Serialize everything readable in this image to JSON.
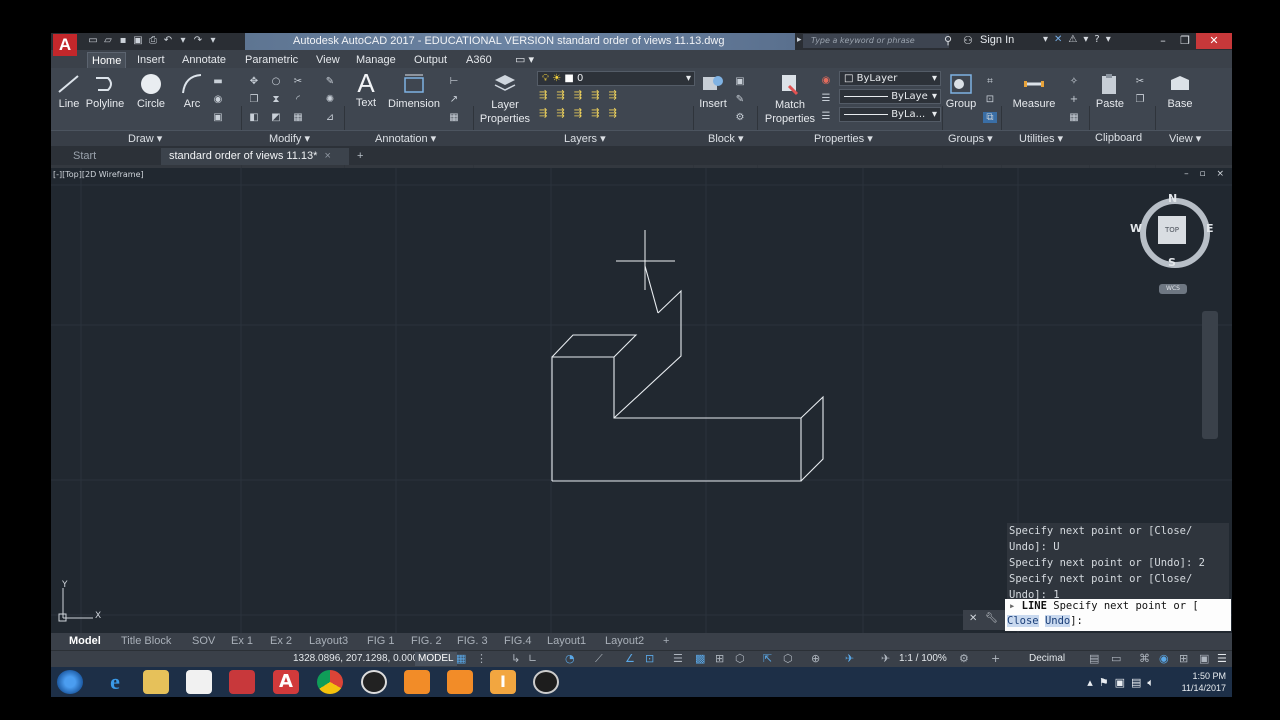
{
  "titlebar": {
    "app_logo": "A",
    "title": "Autodesk AutoCAD 2017 - EDUCATIONAL VERSION    standard order of views 11.13.dwg",
    "search_placeholder": "Type a keyword or phrase",
    "sign_in": "Sign In",
    "window_controls": [
      "–",
      "❐",
      "✕"
    ]
  },
  "ribbon_tabs": [
    "Home",
    "Insert",
    "Annotate",
    "Parametric",
    "View",
    "Manage",
    "Output",
    "A360"
  ],
  "ribbon": {
    "draw": {
      "line": "Line",
      "polyline": "Polyline",
      "circle": "Circle",
      "arc": "Arc",
      "panel": "Draw ▾"
    },
    "modify": {
      "panel": "Modify ▾"
    },
    "annotation": {
      "text": "Text",
      "dimension": "Dimension",
      "panel": "Annotation ▾"
    },
    "layers": {
      "layer_properties": "Layer Properties",
      "current_layer": "0",
      "panel": "Layers ▾"
    },
    "block": {
      "insert": "Insert",
      "panel": "Block ▾"
    },
    "properties": {
      "match": "Match Properties",
      "color": "ByLayer",
      "linetype": "ByLaye",
      "lineweight": "ByLa...",
      "panel": "Properties ▾"
    },
    "groups": {
      "group": "Group",
      "panel": "Groups ▾"
    },
    "utilities": {
      "measure": "Measure",
      "panel": "Utilities ▾"
    },
    "clipboard": {
      "paste": "Paste",
      "panel": "Clipboard"
    },
    "view": {
      "base": "Base",
      "panel": "View ▾"
    }
  },
  "file_tabs": {
    "start": "Start",
    "active": "standard order of views 11.13*",
    "close": "×",
    "add": "+"
  },
  "viewport": {
    "label": "[-][Top][2D Wireframe]",
    "controls": "– ▫ ×",
    "viewcube": {
      "n": "N",
      "s": "S",
      "e": "E",
      "w": "W",
      "face": "TOP",
      "wcs": "WCS"
    },
    "ucs": {
      "x": "X",
      "y": "Y"
    }
  },
  "command_history": [
    "Specify next point or [Close/",
    "Undo]: U",
    "Specify next point or [Undo]: 2",
    "Specify next point or [Close/",
    "Undo]: 1"
  ],
  "command_input": {
    "line1_cmd": "LINE",
    "line1_rest": " Specify next point or [",
    "close": "Close",
    "undo": "Undo",
    "tail": "]:"
  },
  "layout_tabs": [
    "Model",
    "Title Block",
    "SOV",
    "Ex 1",
    "Ex 2",
    "Layout3",
    "FIG 1",
    "FIG. 2",
    "FIG. 3",
    "FIG.4",
    "Layout1",
    "Layout2",
    "+"
  ],
  "status": {
    "coords": "1328.0896, 207.1298, 0.0000",
    "model": "MODEL",
    "scale": "1:1 / 100%",
    "units": "Decimal"
  },
  "taskbar": {
    "time": "1:50 PM",
    "date": "11/14/2017"
  }
}
